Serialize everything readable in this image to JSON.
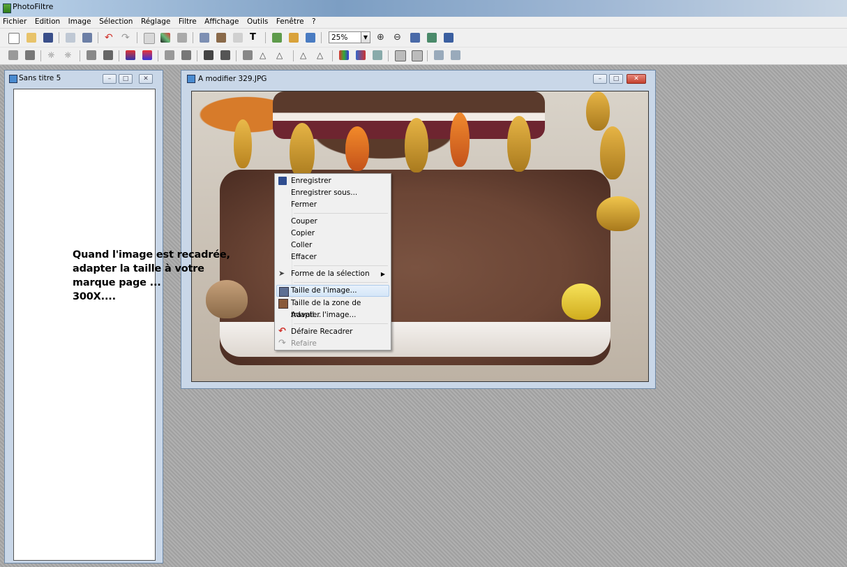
{
  "app": {
    "title": "PhotoFiltre"
  },
  "menubar": [
    "Fichier",
    "Edition",
    "Image",
    "Sélection",
    "Réglage",
    "Filtre",
    "Affichage",
    "Outils",
    "Fenêtre",
    "?"
  ],
  "toolbar": {
    "zoom_value": "25%"
  },
  "left_window": {
    "title": "Sans titre 5"
  },
  "image_window": {
    "title": "A modifier 329.JPG"
  },
  "context_menu": {
    "items": [
      {
        "label": "Enregistrer",
        "icon": "save-icon"
      },
      {
        "label": "Enregistrer sous..."
      },
      {
        "label": "Fermer"
      },
      {
        "label": "Couper"
      },
      {
        "label": "Copier"
      },
      {
        "label": "Coller"
      },
      {
        "label": "Effacer"
      },
      {
        "label": "Forme de la sélection",
        "icon": "selection-pointer-icon"
      },
      {
        "label": "Taille de l'image...",
        "icon": "image-size-icon",
        "highlighted": true
      },
      {
        "label": "Taille de la zone de travail...",
        "icon": "canvas-size-icon"
      },
      {
        "label": "Adapter l'image..."
      },
      {
        "label": "Défaire Recadrer",
        "icon": "undo-icon"
      },
      {
        "label": "Refaire",
        "icon": "redo-icon",
        "disabled": true
      }
    ]
  },
  "caption": {
    "lines": [
      "Quand l'image est recadrée,",
      "adapter la taille à votre",
      "marque page ...",
      "300X...."
    ]
  },
  "colors": {
    "highlight": "#d4e6f8",
    "undo_red": "#d0302a",
    "titlebar": "#7c9ec3"
  }
}
